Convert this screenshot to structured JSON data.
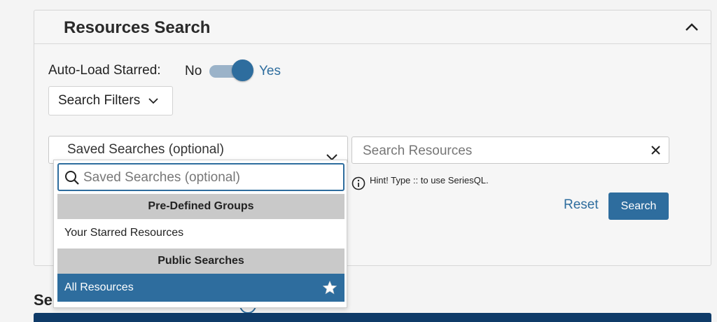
{
  "panel": {
    "title": "Resources Search"
  },
  "autoload": {
    "label": "Auto-Load Starred:",
    "off_label": "No",
    "on_label": "Yes",
    "value": true
  },
  "filters": {
    "label": "Search Filters"
  },
  "saved_searches": {
    "placeholder": "Saved Searches (optional)",
    "dropdown": {
      "search_placeholder": "Saved Searches (optional)",
      "groups": [
        {
          "label": "Pre-Defined Groups",
          "items": [
            {
              "label": "Your Starred Resources",
              "selected": false
            }
          ]
        },
        {
          "label": "Public Searches",
          "items": [
            {
              "label": "All Resources",
              "selected": true,
              "starred": true
            }
          ]
        }
      ]
    }
  },
  "search": {
    "placeholder": "Search Resources",
    "hint": "Hint! Type :: to use SeriesQL."
  },
  "actions": {
    "reset_label": "Reset",
    "search_label": "Search"
  },
  "background": {
    "partial_heading": "Se"
  },
  "colors": {
    "accent": "#2e6d9e",
    "group_bg": "#c9c9c9",
    "navbar": "#0f3b68"
  }
}
